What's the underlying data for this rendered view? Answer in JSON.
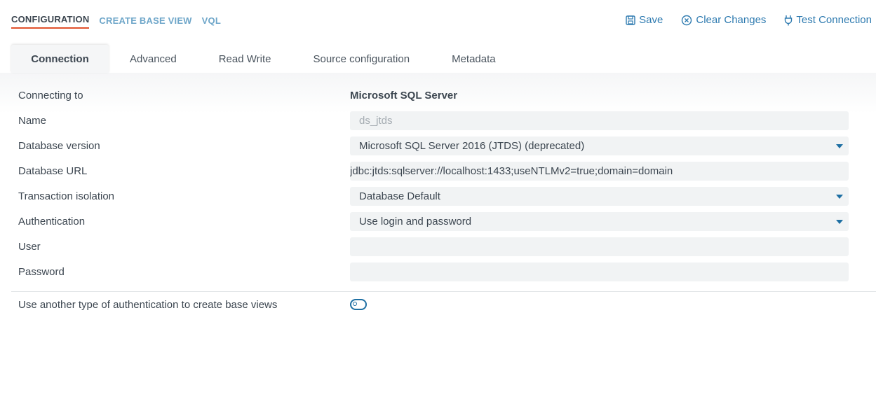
{
  "topnav": {
    "items": [
      {
        "label": "CONFIGURATION"
      },
      {
        "label": "CREATE BASE VIEW"
      },
      {
        "label": "VQL"
      }
    ]
  },
  "actions": {
    "save": {
      "label": "Save",
      "icon": "save-icon"
    },
    "clear": {
      "label": "Clear Changes",
      "icon": "clear-icon"
    },
    "test": {
      "label": "Test Connection",
      "icon": "plug-icon"
    }
  },
  "tabs": [
    {
      "label": "Connection"
    },
    {
      "label": "Advanced"
    },
    {
      "label": "Read Write"
    },
    {
      "label": "Source configuration"
    },
    {
      "label": "Metadata"
    }
  ],
  "form": {
    "connecting_to": {
      "label": "Connecting to",
      "value": "Microsoft SQL Server"
    },
    "name": {
      "label": "Name",
      "value": "ds_jtds"
    },
    "database_version": {
      "label": "Database version",
      "value": "Microsoft SQL Server 2016 (JTDS) (deprecated)"
    },
    "database_url": {
      "label": "Database URL",
      "value": "jdbc:jtds:sqlserver://localhost:1433;useNTLMv2=true;domain=domain"
    },
    "transaction_isolation": {
      "label": "Transaction isolation",
      "value": "Database Default"
    },
    "authentication": {
      "label": "Authentication",
      "value": "Use login and password"
    },
    "user": {
      "label": "User",
      "value": ""
    },
    "password": {
      "label": "Password",
      "value": ""
    },
    "alt_auth": {
      "label": "Use another type of authentication to create base views",
      "enabled": false
    }
  },
  "colors": {
    "accent": "#1e6fa3",
    "active_underline": "#e0512c",
    "field_bg": "#f1f3f4"
  }
}
